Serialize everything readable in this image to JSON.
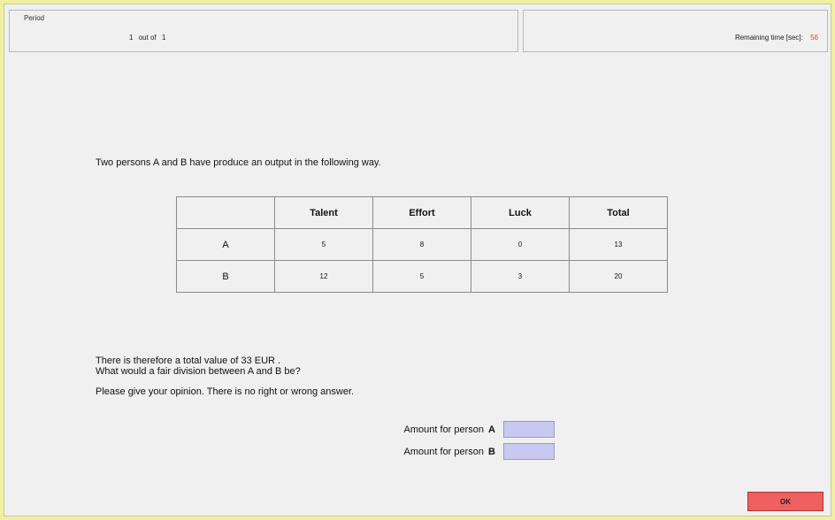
{
  "header": {
    "period_legend": "Period",
    "period_current": "1",
    "period_separator": "out of",
    "period_total": "1",
    "remaining_label": "Remaining time [sec]:",
    "remaining_value": "56",
    "remaining_color": "#e04040"
  },
  "main": {
    "intro": "Two persons A and B have produce an output in the following way.",
    "table": {
      "headers": [
        "",
        "Talent",
        "Effort",
        "Luck",
        "Total"
      ],
      "rows": [
        {
          "label": "A",
          "cells": [
            "5",
            "8",
            "0",
            "13"
          ]
        },
        {
          "label": "B",
          "cells": [
            "12",
            "5",
            "3",
            "20"
          ]
        }
      ]
    },
    "total_text": "There is therefore a total value of 33 EUR .",
    "fair_question": "What would a fair division between A and B be?",
    "opinion_text": "Please give your opinion. There is no right or wrong answer.",
    "amount_a": {
      "label": "Amount for person",
      "person": "A",
      "value": ""
    },
    "amount_b": {
      "label": "Amount for person",
      "person": "B",
      "value": ""
    }
  },
  "footer": {
    "ok_label": "OK",
    "ok_color": "#f06060"
  },
  "colors": {
    "frame_background": "#f0f0a0",
    "input_background": "#c8c8f0"
  }
}
